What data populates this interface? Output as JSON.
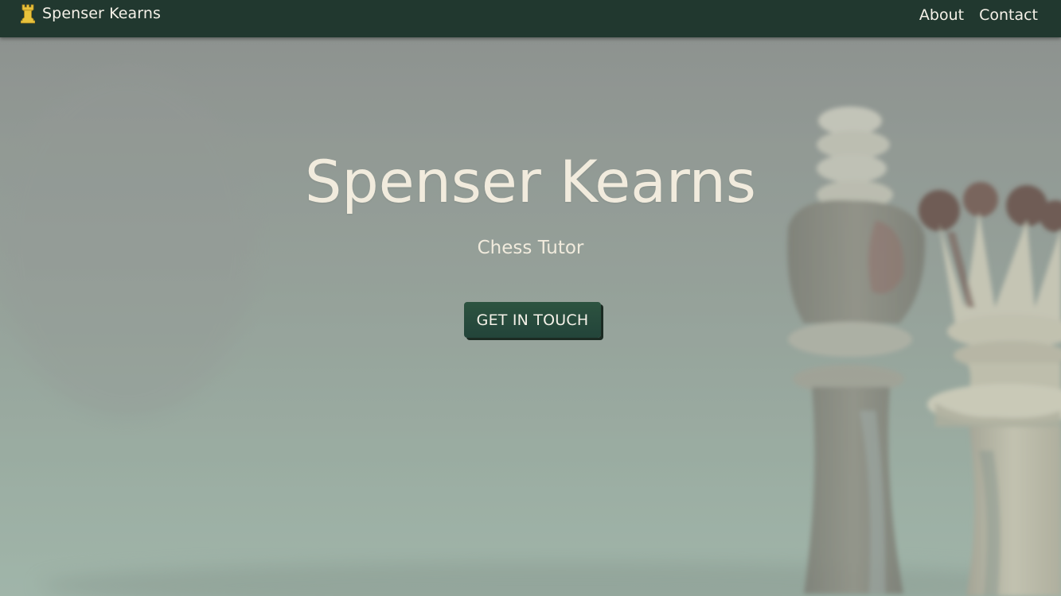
{
  "nav": {
    "brand_icon": "rook-icon",
    "brand_label": "Spenser Kearns",
    "links": [
      {
        "label": "About"
      },
      {
        "label": "Contact"
      }
    ]
  },
  "hero": {
    "title": "Spenser Kearns",
    "subtitle": "Chess Tutor",
    "cta_label": "GET IN TOUCH",
    "background_image": "chess-pieces-photo"
  },
  "colors": {
    "nav_background": "#21382f",
    "text_light": "#f1ebdd",
    "button_background": "#2d5340",
    "brand_icon_color": "#e9c33c"
  }
}
